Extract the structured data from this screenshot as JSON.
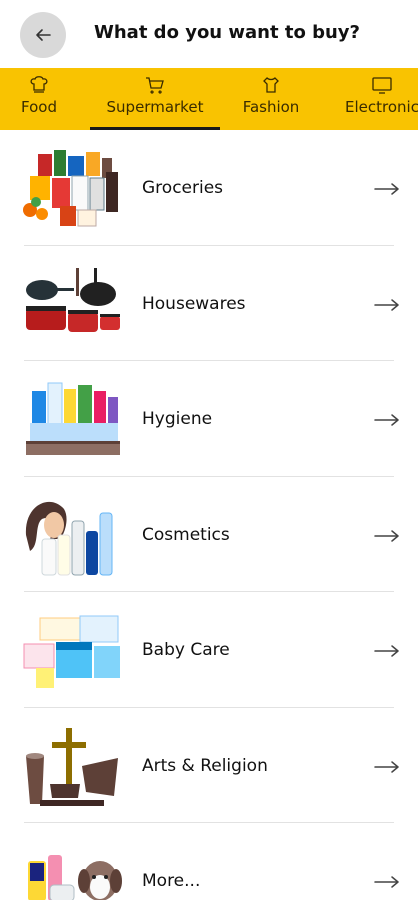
{
  "header": {
    "title": "What do you want to buy?",
    "back_icon": "arrow-left-icon"
  },
  "tabs": [
    {
      "label": "Food",
      "icon": "chef-hat-icon",
      "selected": false
    },
    {
      "label": "Supermarket",
      "icon": "cart-icon",
      "selected": true
    },
    {
      "label": "Fashion",
      "icon": "dress-icon",
      "selected": false
    },
    {
      "label": "Electronic",
      "icon": "monitor-icon",
      "selected": false
    }
  ],
  "categories": [
    {
      "label": "Groceries",
      "image": "groceries-image"
    },
    {
      "label": "Housewares",
      "image": "cookware-image"
    },
    {
      "label": "Hygiene",
      "image": "hygiene-products-image"
    },
    {
      "label": "Cosmetics",
      "image": "cosmetics-image"
    },
    {
      "label": "Baby Care",
      "image": "baby-care-image"
    },
    {
      "label": "Arts & Religion",
      "image": "arts-religion-image"
    },
    {
      "label": "More...",
      "image": "more-products-image"
    }
  ],
  "colors": {
    "accent": "#f9c301",
    "back_button_bg": "#d9d9d9",
    "text": "#111111"
  }
}
